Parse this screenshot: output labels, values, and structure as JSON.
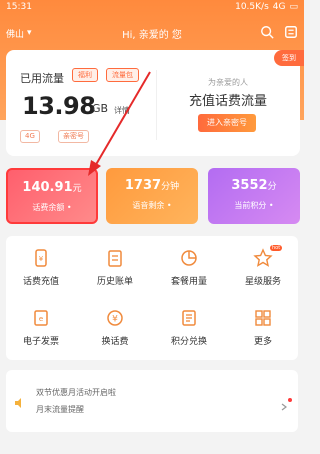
{
  "status_bar": {
    "time": "15:31",
    "net": "10.5K/s",
    "battery": "4G"
  },
  "top_bar": {
    "location": "佛山",
    "greeting": "Hi, 亲爱的 您"
  },
  "flow_card": {
    "title": "已用流量",
    "tags": [
      "福利",
      "流量包"
    ],
    "amount": "13.98",
    "unit": "GB",
    "detail_link": "详情",
    "chips": [
      "4G",
      "亲密号"
    ],
    "for_you": "为亲爱的人",
    "recharge_title": "充值话费流量",
    "enter_button": "进入亲密号",
    "badge": "签到"
  },
  "stats": [
    {
      "value": "140.91",
      "unit": "元",
      "label": "话费余额 •"
    },
    {
      "value": "1737",
      "unit": "分钟",
      "label": "语音剩余 •"
    },
    {
      "value": "3552",
      "unit": "分",
      "label": "当前积分 •"
    }
  ],
  "services": [
    {
      "label": "话费充值",
      "icon": "phone-recharge-icon"
    },
    {
      "label": "历史账单",
      "icon": "bill-icon"
    },
    {
      "label": "套餐用量",
      "icon": "pie-chart-icon"
    },
    {
      "label": "星级服务",
      "icon": "star-icon",
      "badge": "hot"
    },
    {
      "label": "电子发票",
      "icon": "invoice-icon"
    },
    {
      "label": "换话费",
      "icon": "yuan-icon"
    },
    {
      "label": "积分兑换",
      "icon": "points-icon"
    },
    {
      "label": "更多",
      "icon": "more-grid-icon"
    }
  ],
  "notice": {
    "line1": "双节优惠月活动开启啦",
    "line2": "月末流量提醒"
  },
  "colors": {
    "brand_orange": "#ff8a3d",
    "arrow_red": "#e52a2a"
  }
}
